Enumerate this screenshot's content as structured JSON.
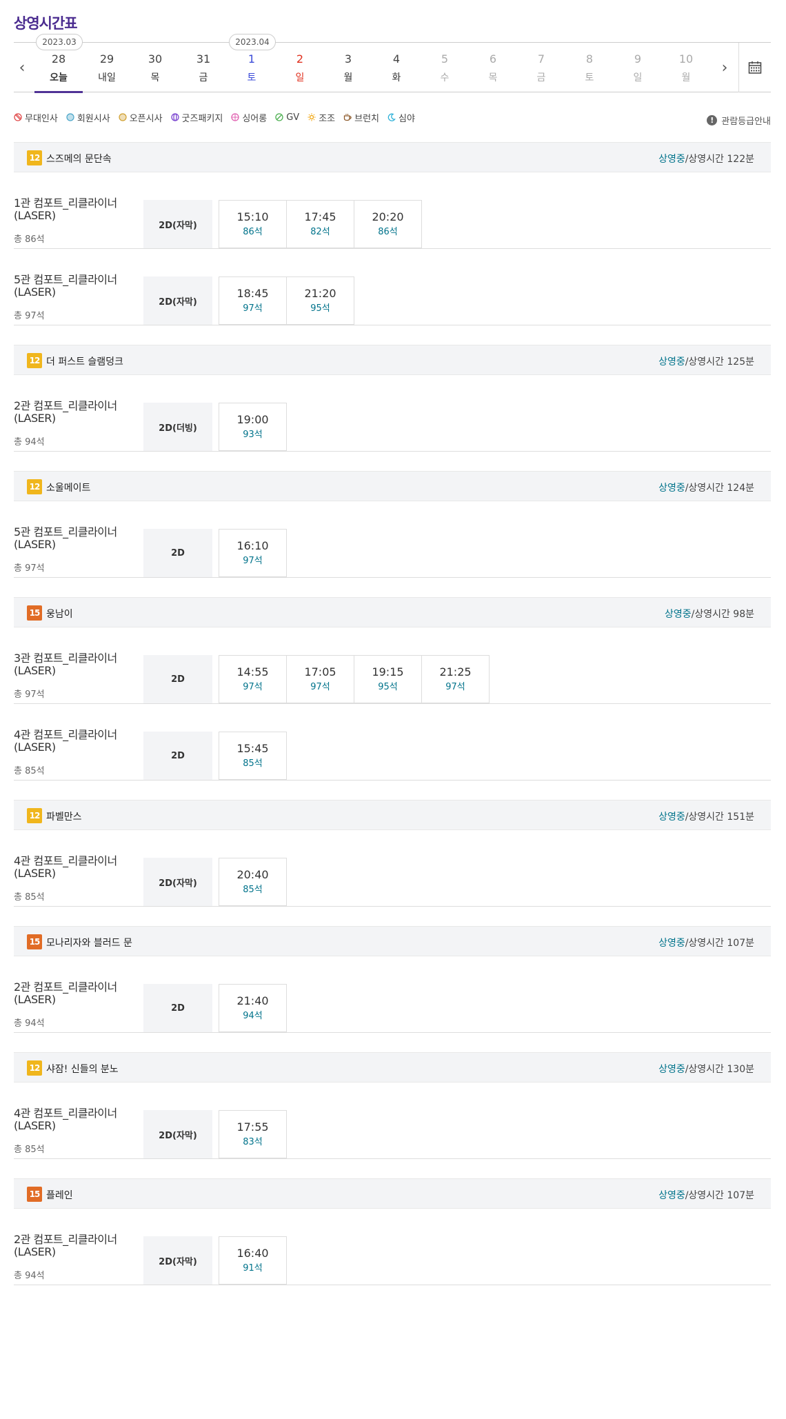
{
  "title": "상영시간표",
  "dates": {
    "months": [
      "2023.03",
      "2023.04"
    ],
    "items": [
      {
        "num": "28",
        "day": "오늘",
        "state": "sel"
      },
      {
        "num": "29",
        "day": "내일",
        "state": ""
      },
      {
        "num": "30",
        "day": "목",
        "state": ""
      },
      {
        "num": "31",
        "day": "금",
        "state": ""
      },
      {
        "num": "1",
        "day": "토",
        "state": "sat"
      },
      {
        "num": "2",
        "day": "일",
        "state": "sun"
      },
      {
        "num": "3",
        "day": "월",
        "state": ""
      },
      {
        "num": "4",
        "day": "화",
        "state": ""
      },
      {
        "num": "5",
        "day": "수",
        "state": "dis"
      },
      {
        "num": "6",
        "day": "목",
        "state": "dis"
      },
      {
        "num": "7",
        "day": "금",
        "state": "dis"
      },
      {
        "num": "8",
        "day": "토",
        "state": "dis"
      },
      {
        "num": "9",
        "day": "일",
        "state": "dis"
      },
      {
        "num": "10",
        "day": "월",
        "state": "dis"
      }
    ]
  },
  "legend": [
    {
      "label": "무대인사",
      "icon": "no-entry-icon",
      "color": "#e04848"
    },
    {
      "label": "회원시사",
      "icon": "circle-icon",
      "color": "#4aa5c8"
    },
    {
      "label": "오픈시사",
      "icon": "circle-icon",
      "color": "#d0a030"
    },
    {
      "label": "굿즈패키지",
      "icon": "globe-icon",
      "color": "#7a44d0"
    },
    {
      "label": "싱어롱",
      "icon": "grid-circle-icon",
      "color": "#e060b0"
    },
    {
      "label": "GV",
      "icon": "slash-circle-icon",
      "color": "#4caf50"
    },
    {
      "label": "조조",
      "icon": "sun-icon",
      "color": "#f0a000"
    },
    {
      "label": "브런치",
      "icon": "cup-icon",
      "color": "#8d5a2b"
    },
    {
      "label": "심야",
      "icon": "moon-icon",
      "color": "#2bb0d8"
    }
  ],
  "rating_guide": "관람등급안내",
  "status_now": "상영중",
  "status_runtime_prefix": "/상영시간 ",
  "movies": [
    {
      "age": "12",
      "title": "스즈메의 문단속",
      "runtime": "122분",
      "screens": [
        {
          "hall": "1관 컴포트_리클라이너 (LASER)",
          "total": "총 86석",
          "format": "2D(자막)",
          "times": [
            {
              "t": "15:10",
              "s": "86석"
            },
            {
              "t": "17:45",
              "s": "82석"
            },
            {
              "t": "20:20",
              "s": "86석"
            }
          ]
        },
        {
          "hall": "5관 컴포트_리클라이너 (LASER)",
          "total": "총 97석",
          "format": "2D(자막)",
          "times": [
            {
              "t": "18:45",
              "s": "97석"
            },
            {
              "t": "21:20",
              "s": "95석"
            }
          ]
        }
      ]
    },
    {
      "age": "12",
      "title": "더 퍼스트 슬램덩크",
      "runtime": "125분",
      "screens": [
        {
          "hall": "2관 컴포트_리클라이너 (LASER)",
          "total": "총 94석",
          "format": "2D(더빙)",
          "times": [
            {
              "t": "19:00",
              "s": "93석"
            }
          ]
        }
      ]
    },
    {
      "age": "12",
      "title": "소울메이트",
      "runtime": "124분",
      "screens": [
        {
          "hall": "5관 컴포트_리클라이너 (LASER)",
          "total": "총 97석",
          "format": "2D",
          "times": [
            {
              "t": "16:10",
              "s": "97석"
            }
          ]
        }
      ]
    },
    {
      "age": "15",
      "title": "웅남이",
      "runtime": "98분",
      "screens": [
        {
          "hall": "3관 컴포트_리클라이너 (LASER)",
          "total": "총 97석",
          "format": "2D",
          "times": [
            {
              "t": "14:55",
              "s": "97석"
            },
            {
              "t": "17:05",
              "s": "97석"
            },
            {
              "t": "19:15",
              "s": "95석"
            },
            {
              "t": "21:25",
              "s": "97석"
            }
          ]
        },
        {
          "hall": "4관 컴포트_리클라이너 (LASER)",
          "total": "총 85석",
          "format": "2D",
          "times": [
            {
              "t": "15:45",
              "s": "85석"
            }
          ]
        }
      ]
    },
    {
      "age": "12",
      "title": "파벨만스",
      "runtime": "151분",
      "screens": [
        {
          "hall": "4관 컴포트_리클라이너 (LASER)",
          "total": "총 85석",
          "format": "2D(자막)",
          "times": [
            {
              "t": "20:40",
              "s": "85석"
            }
          ]
        }
      ]
    },
    {
      "age": "15",
      "title": "모나리자와 블러드 문",
      "runtime": "107분",
      "screens": [
        {
          "hall": "2관 컴포트_리클라이너 (LASER)",
          "total": "총 94석",
          "format": "2D",
          "times": [
            {
              "t": "21:40",
              "s": "94석"
            }
          ]
        }
      ]
    },
    {
      "age": "12",
      "title": "샤잠! 신들의 분노",
      "runtime": "130분",
      "screens": [
        {
          "hall": "4관 컴포트_리클라이너 (LASER)",
          "total": "총 85석",
          "format": "2D(자막)",
          "times": [
            {
              "t": "17:55",
              "s": "83석"
            }
          ]
        }
      ]
    },
    {
      "age": "15",
      "title": "플레인",
      "runtime": "107분",
      "screens": [
        {
          "hall": "2관 컴포트_리클라이너 (LASER)",
          "total": "총 94석",
          "format": "2D(자막)",
          "times": [
            {
              "t": "16:40",
              "s": "91석"
            }
          ]
        }
      ]
    }
  ]
}
